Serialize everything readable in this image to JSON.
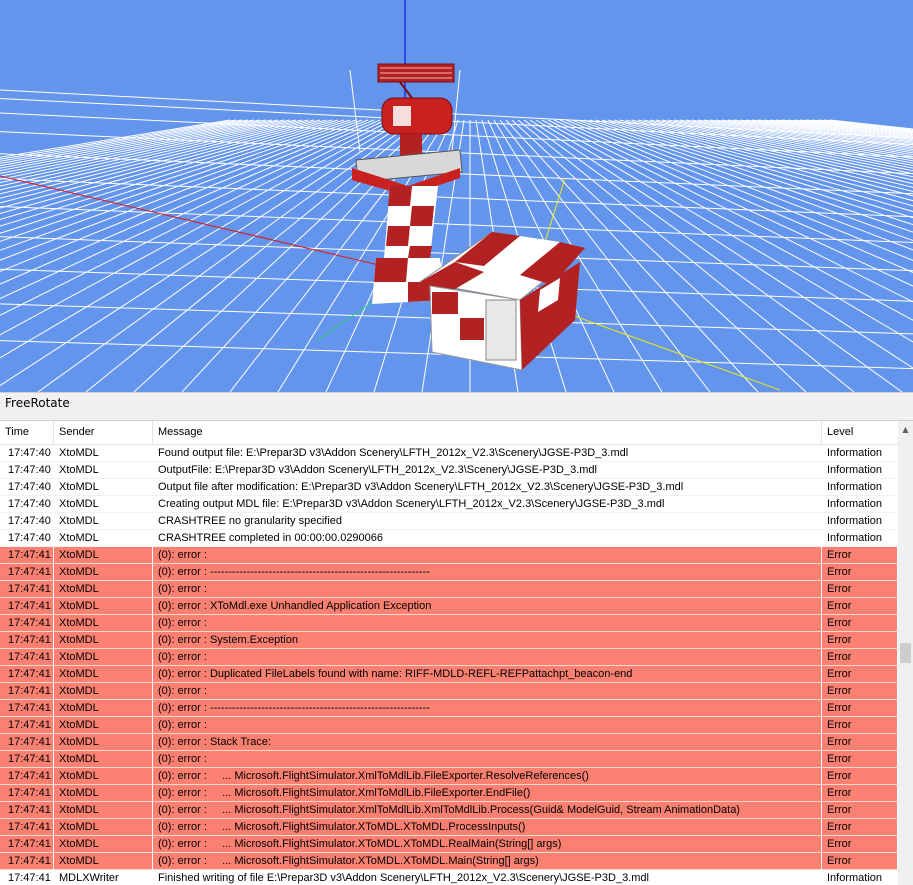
{
  "viewport": {
    "background": "#6495ed",
    "grid_color": "#ffffff"
  },
  "mode_bar": {
    "label": "FreeRotate"
  },
  "log": {
    "columns": {
      "time": "Time",
      "sender": "Sender",
      "message": "Message",
      "level": "Level"
    },
    "colors": {
      "error_row": "#fa8072",
      "info_row": "#ffffff"
    },
    "rows": [
      {
        "time": "17:47:40",
        "sender": "XtoMDL",
        "message": "Found output file: E:\\Prepar3D v3\\Addon Scenery\\LFTH_2012x_V2.3\\Scenery\\JGSE-P3D_3.mdl",
        "level": "Information"
      },
      {
        "time": "17:47:40",
        "sender": "XtoMDL",
        "message": "OutputFile: E:\\Prepar3D v3\\Addon Scenery\\LFTH_2012x_V2.3\\Scenery\\JGSE-P3D_3.mdl",
        "level": "Information"
      },
      {
        "time": "17:47:40",
        "sender": "XtoMDL",
        "message": "Output file after modification: E:\\Prepar3D v3\\Addon Scenery\\LFTH_2012x_V2.3\\Scenery\\JGSE-P3D_3.mdl",
        "level": "Information"
      },
      {
        "time": "17:47:40",
        "sender": "XtoMDL",
        "message": "Creating output MDL file: E:\\Prepar3D v3\\Addon Scenery\\LFTH_2012x_V2.3\\Scenery\\JGSE-P3D_3.mdl",
        "level": "Information"
      },
      {
        "time": "17:47:40",
        "sender": "XtoMDL",
        "message": "CRASHTREE no granularity specified",
        "level": "Information"
      },
      {
        "time": "17:47:40",
        "sender": "XtoMDL",
        "message": "CRASHTREE completed in 00:00:00.0290066",
        "level": "Information"
      },
      {
        "time": "17:47:41",
        "sender": "XtoMDL",
        "message": "(0): error :",
        "level": "Error"
      },
      {
        "time": "17:47:41",
        "sender": "XtoMDL",
        "message": "(0): error : ------------------------------------------------------------",
        "level": "Error"
      },
      {
        "time": "17:47:41",
        "sender": "XtoMDL",
        "message": "(0): error :",
        "level": "Error"
      },
      {
        "time": "17:47:41",
        "sender": "XtoMDL",
        "message": "(0): error : XToMdl.exe Unhandled Application Exception",
        "level": "Error"
      },
      {
        "time": "17:47:41",
        "sender": "XtoMDL",
        "message": "(0): error :",
        "level": "Error"
      },
      {
        "time": "17:47:41",
        "sender": "XtoMDL",
        "message": "(0): error : System.Exception",
        "level": "Error"
      },
      {
        "time": "17:47:41",
        "sender": "XtoMDL",
        "message": "(0): error :",
        "level": "Error"
      },
      {
        "time": "17:47:41",
        "sender": "XtoMDL",
        "message": "(0): error : Duplicated FileLabels found with name: RIFF-MDLD-REFL-REFPattachpt_beacon-end",
        "level": "Error"
      },
      {
        "time": "17:47:41",
        "sender": "XtoMDL",
        "message": "(0): error :",
        "level": "Error"
      },
      {
        "time": "17:47:41",
        "sender": "XtoMDL",
        "message": "(0): error : ------------------------------------------------------------",
        "level": "Error"
      },
      {
        "time": "17:47:41",
        "sender": "XtoMDL",
        "message": "(0): error :",
        "level": "Error"
      },
      {
        "time": "17:47:41",
        "sender": "XtoMDL",
        "message": "(0): error : Stack Trace:",
        "level": "Error"
      },
      {
        "time": "17:47:41",
        "sender": "XtoMDL",
        "message": "(0): error :",
        "level": "Error"
      },
      {
        "time": "17:47:41",
        "sender": "XtoMDL",
        "message": "(0): error :     ... Microsoft.FlightSimulator.XmlToMdlLib.FileExporter.ResolveReferences()",
        "level": "Error"
      },
      {
        "time": "17:47:41",
        "sender": "XtoMDL",
        "message": "(0): error :     ... Microsoft.FlightSimulator.XmlToMdlLib.FileExporter.EndFile()",
        "level": "Error"
      },
      {
        "time": "17:47:41",
        "sender": "XtoMDL",
        "message": "(0): error :     ... Microsoft.FlightSimulator.XmlToMdlLib.XmlToMdlLib.Process(Guid& ModelGuid, Stream AnimationData)",
        "level": "Error"
      },
      {
        "time": "17:47:41",
        "sender": "XtoMDL",
        "message": "(0): error :     ... Microsoft.FlightSimulator.XToMDL.XToMDL.ProcessInputs()",
        "level": "Error"
      },
      {
        "time": "17:47:41",
        "sender": "XtoMDL",
        "message": "(0): error :     ... Microsoft.FlightSimulator.XToMDL.XToMDL.RealMain(String[] args)",
        "level": "Error"
      },
      {
        "time": "17:47:41",
        "sender": "XtoMDL",
        "message": "(0): error :     ... Microsoft.FlightSimulator.XToMDL.XToMDL.Main(String[] args)",
        "level": "Error"
      },
      {
        "time": "17:47:41",
        "sender": "MDLXWriter",
        "message": "Finished writing of file E:\\Prepar3D v3\\Addon Scenery\\LFTH_2012x_V2.3\\Scenery\\JGSE-P3D_3.mdl",
        "level": "Information"
      }
    ]
  },
  "scrollbar": {
    "up_icon": "triangle-up-icon"
  }
}
